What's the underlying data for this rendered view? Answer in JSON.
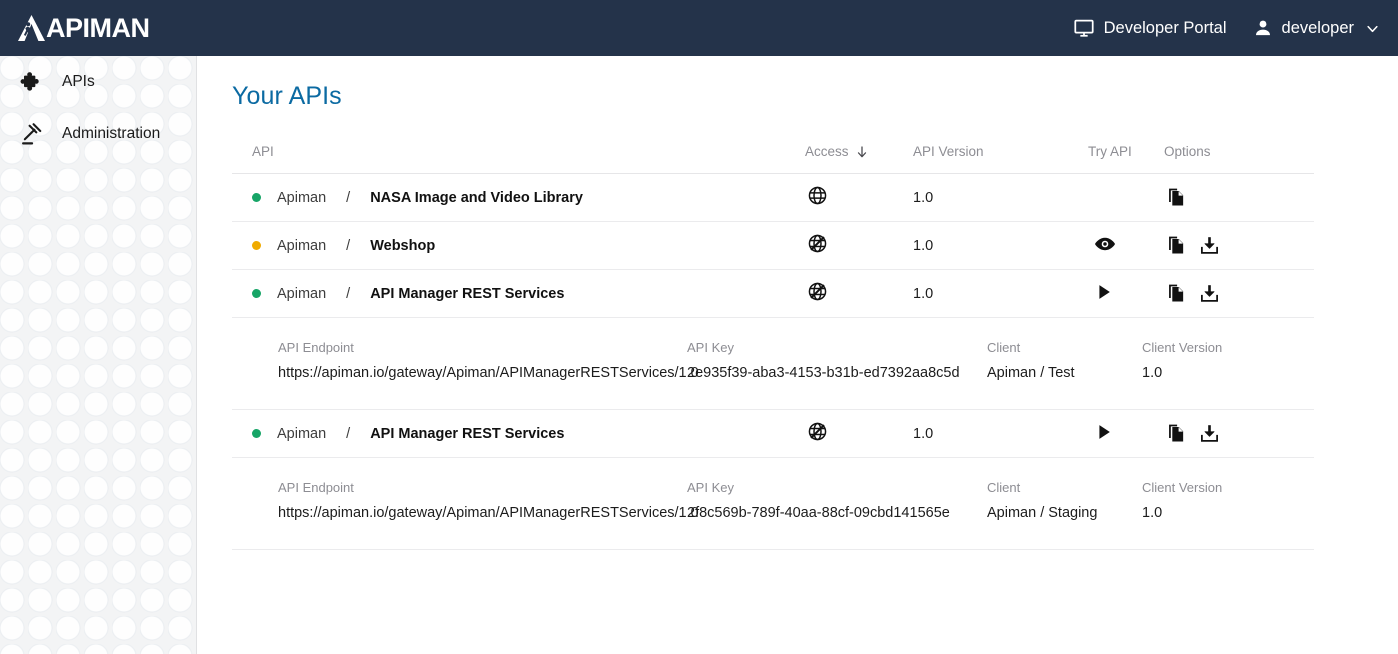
{
  "header": {
    "logo_text": "APIMAN",
    "logo_icon": "apiman-logo-icon",
    "developer_portal_label": "Developer Portal",
    "developer_portal_icon": "monitor-icon",
    "user_label": "developer",
    "user_icon": "person-icon",
    "caret_icon": "chevron-down-icon",
    "bar_color": "#24334a"
  },
  "sidebar": {
    "items": [
      {
        "label": "APIs",
        "icon": "puzzle-piece-icon"
      },
      {
        "label": "Administration",
        "icon": "gavel-icon"
      }
    ]
  },
  "main": {
    "page_title": "Your APIs",
    "table": {
      "columns": {
        "api": "API",
        "access": "Access",
        "access_sort_icon": "arrow-down-icon",
        "api_version": "API Version",
        "try_api": "Try API",
        "options": "Options"
      },
      "rows": [
        {
          "status": "green",
          "org": "Apiman",
          "separator": "/",
          "name": "NASA Image and Video Library",
          "access_icon": "globe-public-icon",
          "access_state": "public",
          "api_version": "1.0",
          "try_icon": null,
          "options_icons": [
            "copy-icon"
          ],
          "expanded": false
        },
        {
          "status": "amber",
          "org": "Apiman",
          "separator": "/",
          "name": "Webshop",
          "access_icon": "globe-off-icon",
          "access_state": "not-public",
          "api_version": "1.0",
          "try_icon": "eye-icon",
          "options_icons": [
            "copy-icon",
            "download-icon"
          ],
          "expanded": false
        },
        {
          "status": "green",
          "org": "Apiman",
          "separator": "/",
          "name": "API Manager REST Services",
          "access_icon": "globe-off-icon",
          "access_state": "not-public",
          "api_version": "1.0",
          "try_icon": "play-icon",
          "options_icons": [
            "copy-icon",
            "download-icon"
          ],
          "expanded": true,
          "detail": {
            "endpoint_label": "API Endpoint",
            "endpoint_value": "https://apiman.io/gateway/Apiman/APIManagerRESTServices/1.0",
            "key_label": "API Key",
            "key_value": "2e935f39-aba3-4153-b31b-ed7392aa8c5d",
            "client_label": "Client",
            "client_value": "Apiman / Test",
            "client_version_label": "Client Version",
            "client_version_value": "1.0"
          }
        },
        {
          "status": "green",
          "org": "Apiman",
          "separator": "/",
          "name": "API Manager REST Services",
          "access_icon": "globe-off-icon",
          "access_state": "not-public",
          "api_version": "1.0",
          "try_icon": "play-icon",
          "options_icons": [
            "copy-icon",
            "download-icon"
          ],
          "expanded": true,
          "detail": {
            "endpoint_label": "API Endpoint",
            "endpoint_value": "https://apiman.io/gateway/Apiman/APIManagerRESTServices/1.0",
            "key_label": "API Key",
            "key_value": "2f8c569b-789f-40aa-88cf-09cbd141565e",
            "client_label": "Client",
            "client_value": "Apiman / Staging",
            "client_version_label": "Client Version",
            "client_version_value": "1.0"
          }
        }
      ]
    }
  },
  "colors": {
    "header_bg": "#24334a",
    "title_blue": "#0b6aa2",
    "status_green": "#17a567",
    "status_amber": "#f0ab00",
    "sidebar_bg": "#f3f4f5",
    "muted_text": "#8d8d93"
  }
}
